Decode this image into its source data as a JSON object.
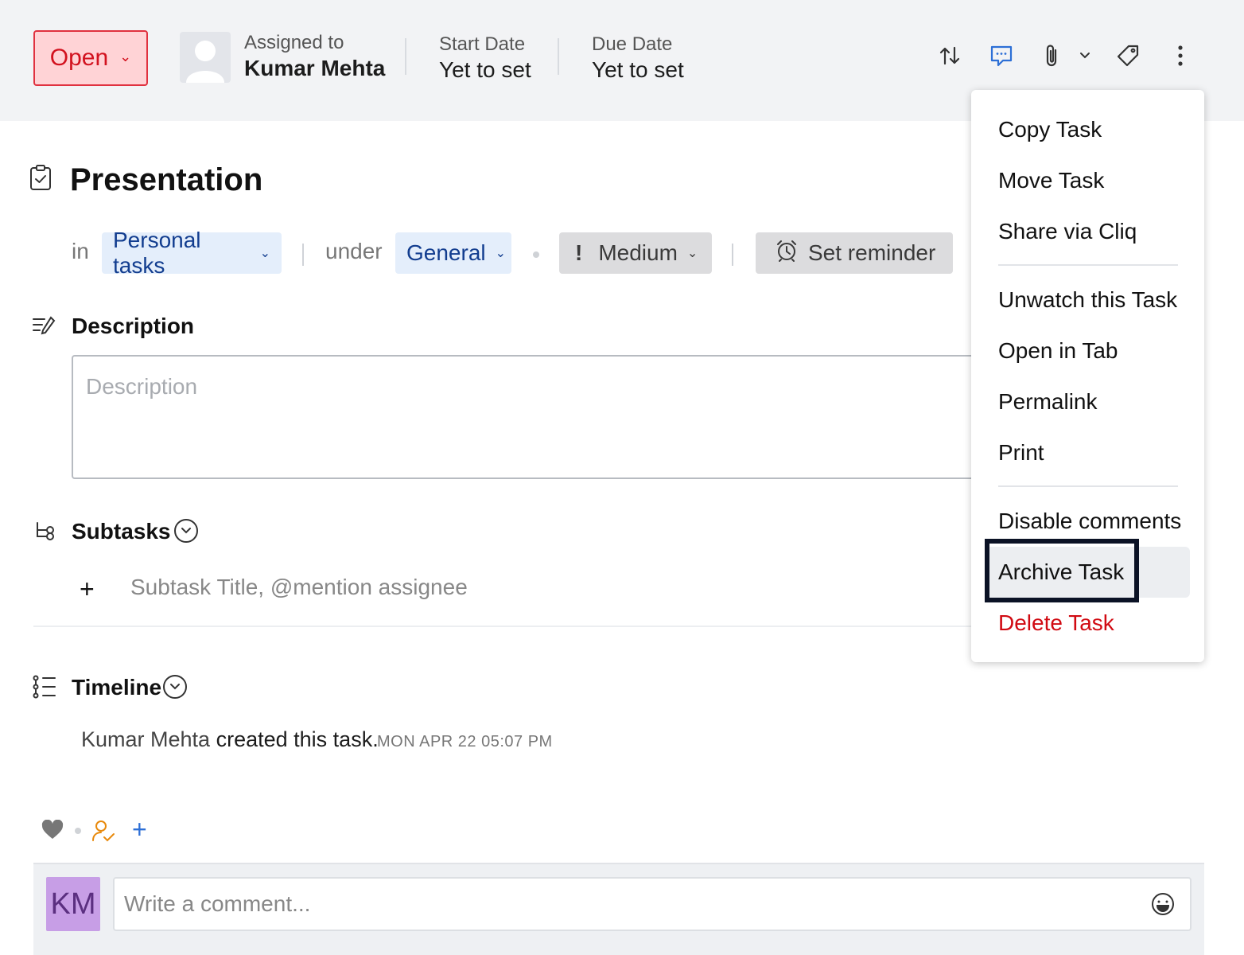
{
  "header": {
    "status": "Open",
    "assigned_label": "Assigned to",
    "assigned_name": "Kumar Mehta",
    "start_label": "Start Date",
    "start_value": "Yet to set",
    "due_label": "Due Date",
    "due_value": "Yet to set",
    "icons": [
      "swap-icon",
      "comment-chat-icon",
      "attachment-icon",
      "chevron-down-icon",
      "tag-icon",
      "more-vertical-icon"
    ]
  },
  "task": {
    "title": "Presentation",
    "in_label": "in",
    "list": "Personal tasks",
    "under_label": "under",
    "section": "General",
    "priority_mark": "!",
    "priority": "Medium",
    "reminder": "Set reminder"
  },
  "description": {
    "heading": "Description",
    "placeholder": "Description"
  },
  "subtasks": {
    "heading": "Subtasks",
    "add": "+",
    "placeholder": "Subtask Title, @mention assignee"
  },
  "timeline": {
    "heading": "Timeline",
    "entry_user": "Kumar Mehta",
    "entry_text": "created this task.",
    "entry_time": "MON APR 22 05:07 PM"
  },
  "reactions": {
    "add": "+"
  },
  "comment": {
    "avatar_initials": "KM",
    "placeholder": "Write a comment..."
  },
  "menu": {
    "items": [
      "Copy Task",
      "Move Task",
      "Share via Cliq",
      "Unwatch this Task",
      "Open in Tab",
      "Permalink",
      "Print",
      "Disable comments",
      "Archive Task",
      "Delete Task"
    ]
  },
  "colors": {
    "status_bg": "#ffd3d6",
    "status_border": "#e0313f",
    "status_text": "#d2121f",
    "chip_blue_bg": "#e4eefb",
    "chip_blue_text": "#123d8f",
    "delete_text": "#d10a12",
    "avatar_bg": "#c79ee6",
    "focus_border": "#0b1225"
  }
}
